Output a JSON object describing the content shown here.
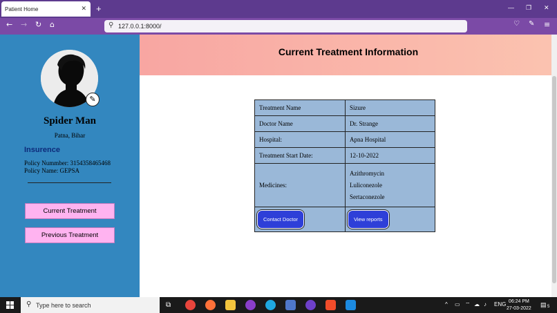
{
  "browser": {
    "tab_title": "Patient Home",
    "tab_close": "✕",
    "new_tab": "+",
    "url": "127.0.0.1:8000/",
    "minimize": "—",
    "restore": "❐",
    "close": "✕"
  },
  "sidebar": {
    "name": "Spider Man",
    "location": "Patna, Bihar",
    "insurance_title": "Insurence",
    "policy_number": "Policy Nummber: 3154358465468",
    "policy_name": "Policy Name: GEPSA",
    "current_treatment_label": "Current Treatment",
    "previous_treatment_label": "Previous Treatment"
  },
  "header": {
    "title": "Current Treatment Information"
  },
  "treatment": {
    "rows": [
      {
        "label": "Treatment Name",
        "value": "Sizure"
      },
      {
        "label": "Doctor Name",
        "value": "Dr. Strange"
      },
      {
        "label": "Hospital:",
        "value": "Apna Hospital"
      },
      {
        "label": "Treatment Start Date:",
        "value": "12-10-2022"
      }
    ],
    "medicines_label": "Medicines:",
    "medicines": [
      "Azithromycin",
      "Luliconezole",
      "Sertaconezole"
    ],
    "contact_label": "Contact Doctor",
    "reports_label": "View reports"
  },
  "taskbar": {
    "search_placeholder": "Type here to search",
    "lang": "ENG",
    "time": "06:24 PM",
    "date": "27-03-2022",
    "notifications": "5"
  },
  "colors": {
    "sidebar": "#3387bf",
    "accent_button": "#2e3fd8",
    "side_button": "#ffb3f0",
    "table_bg": "#9ab8d8"
  }
}
